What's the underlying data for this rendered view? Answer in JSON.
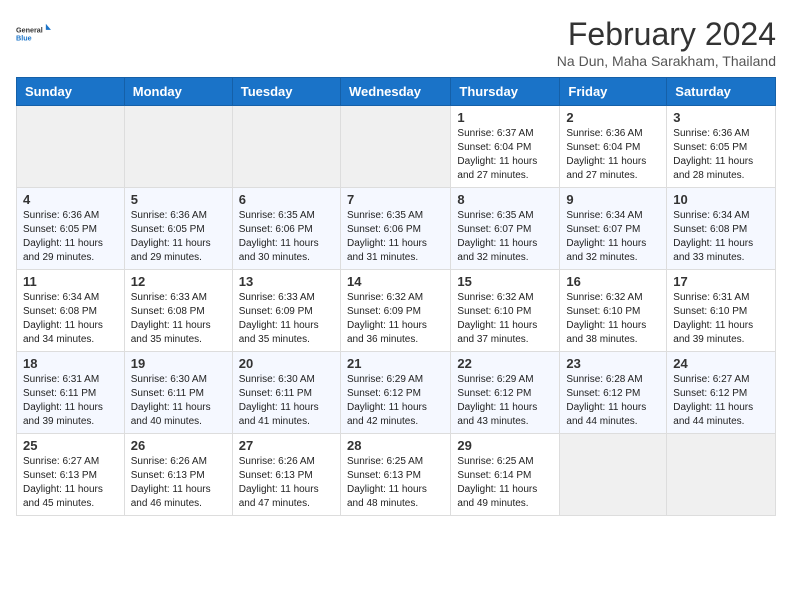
{
  "header": {
    "logo_general": "General",
    "logo_blue": "Blue",
    "month_title": "February 2024",
    "location": "Na Dun, Maha Sarakham, Thailand"
  },
  "weekdays": [
    "Sunday",
    "Monday",
    "Tuesday",
    "Wednesday",
    "Thursday",
    "Friday",
    "Saturday"
  ],
  "weeks": [
    [
      {
        "day": "",
        "sunrise": "",
        "sunset": "",
        "daylight": ""
      },
      {
        "day": "",
        "sunrise": "",
        "sunset": "",
        "daylight": ""
      },
      {
        "day": "",
        "sunrise": "",
        "sunset": "",
        "daylight": ""
      },
      {
        "day": "",
        "sunrise": "",
        "sunset": "",
        "daylight": ""
      },
      {
        "day": "1",
        "sunrise": "Sunrise: 6:37 AM",
        "sunset": "Sunset: 6:04 PM",
        "daylight": "Daylight: 11 hours and 27 minutes."
      },
      {
        "day": "2",
        "sunrise": "Sunrise: 6:36 AM",
        "sunset": "Sunset: 6:04 PM",
        "daylight": "Daylight: 11 hours and 27 minutes."
      },
      {
        "day": "3",
        "sunrise": "Sunrise: 6:36 AM",
        "sunset": "Sunset: 6:05 PM",
        "daylight": "Daylight: 11 hours and 28 minutes."
      }
    ],
    [
      {
        "day": "4",
        "sunrise": "Sunrise: 6:36 AM",
        "sunset": "Sunset: 6:05 PM",
        "daylight": "Daylight: 11 hours and 29 minutes."
      },
      {
        "day": "5",
        "sunrise": "Sunrise: 6:36 AM",
        "sunset": "Sunset: 6:05 PM",
        "daylight": "Daylight: 11 hours and 29 minutes."
      },
      {
        "day": "6",
        "sunrise": "Sunrise: 6:35 AM",
        "sunset": "Sunset: 6:06 PM",
        "daylight": "Daylight: 11 hours and 30 minutes."
      },
      {
        "day": "7",
        "sunrise": "Sunrise: 6:35 AM",
        "sunset": "Sunset: 6:06 PM",
        "daylight": "Daylight: 11 hours and 31 minutes."
      },
      {
        "day": "8",
        "sunrise": "Sunrise: 6:35 AM",
        "sunset": "Sunset: 6:07 PM",
        "daylight": "Daylight: 11 hours and 32 minutes."
      },
      {
        "day": "9",
        "sunrise": "Sunrise: 6:34 AM",
        "sunset": "Sunset: 6:07 PM",
        "daylight": "Daylight: 11 hours and 32 minutes."
      },
      {
        "day": "10",
        "sunrise": "Sunrise: 6:34 AM",
        "sunset": "Sunset: 6:08 PM",
        "daylight": "Daylight: 11 hours and 33 minutes."
      }
    ],
    [
      {
        "day": "11",
        "sunrise": "Sunrise: 6:34 AM",
        "sunset": "Sunset: 6:08 PM",
        "daylight": "Daylight: 11 hours and 34 minutes."
      },
      {
        "day": "12",
        "sunrise": "Sunrise: 6:33 AM",
        "sunset": "Sunset: 6:08 PM",
        "daylight": "Daylight: 11 hours and 35 minutes."
      },
      {
        "day": "13",
        "sunrise": "Sunrise: 6:33 AM",
        "sunset": "Sunset: 6:09 PM",
        "daylight": "Daylight: 11 hours and 35 minutes."
      },
      {
        "day": "14",
        "sunrise": "Sunrise: 6:32 AM",
        "sunset": "Sunset: 6:09 PM",
        "daylight": "Daylight: 11 hours and 36 minutes."
      },
      {
        "day": "15",
        "sunrise": "Sunrise: 6:32 AM",
        "sunset": "Sunset: 6:10 PM",
        "daylight": "Daylight: 11 hours and 37 minutes."
      },
      {
        "day": "16",
        "sunrise": "Sunrise: 6:32 AM",
        "sunset": "Sunset: 6:10 PM",
        "daylight": "Daylight: 11 hours and 38 minutes."
      },
      {
        "day": "17",
        "sunrise": "Sunrise: 6:31 AM",
        "sunset": "Sunset: 6:10 PM",
        "daylight": "Daylight: 11 hours and 39 minutes."
      }
    ],
    [
      {
        "day": "18",
        "sunrise": "Sunrise: 6:31 AM",
        "sunset": "Sunset: 6:11 PM",
        "daylight": "Daylight: 11 hours and 39 minutes."
      },
      {
        "day": "19",
        "sunrise": "Sunrise: 6:30 AM",
        "sunset": "Sunset: 6:11 PM",
        "daylight": "Daylight: 11 hours and 40 minutes."
      },
      {
        "day": "20",
        "sunrise": "Sunrise: 6:30 AM",
        "sunset": "Sunset: 6:11 PM",
        "daylight": "Daylight: 11 hours and 41 minutes."
      },
      {
        "day": "21",
        "sunrise": "Sunrise: 6:29 AM",
        "sunset": "Sunset: 6:12 PM",
        "daylight": "Daylight: 11 hours and 42 minutes."
      },
      {
        "day": "22",
        "sunrise": "Sunrise: 6:29 AM",
        "sunset": "Sunset: 6:12 PM",
        "daylight": "Daylight: 11 hours and 43 minutes."
      },
      {
        "day": "23",
        "sunrise": "Sunrise: 6:28 AM",
        "sunset": "Sunset: 6:12 PM",
        "daylight": "Daylight: 11 hours and 44 minutes."
      },
      {
        "day": "24",
        "sunrise": "Sunrise: 6:27 AM",
        "sunset": "Sunset: 6:12 PM",
        "daylight": "Daylight: 11 hours and 44 minutes."
      }
    ],
    [
      {
        "day": "25",
        "sunrise": "Sunrise: 6:27 AM",
        "sunset": "Sunset: 6:13 PM",
        "daylight": "Daylight: 11 hours and 45 minutes."
      },
      {
        "day": "26",
        "sunrise": "Sunrise: 6:26 AM",
        "sunset": "Sunset: 6:13 PM",
        "daylight": "Daylight: 11 hours and 46 minutes."
      },
      {
        "day": "27",
        "sunrise": "Sunrise: 6:26 AM",
        "sunset": "Sunset: 6:13 PM",
        "daylight": "Daylight: 11 hours and 47 minutes."
      },
      {
        "day": "28",
        "sunrise": "Sunrise: 6:25 AM",
        "sunset": "Sunset: 6:13 PM",
        "daylight": "Daylight: 11 hours and 48 minutes."
      },
      {
        "day": "29",
        "sunrise": "Sunrise: 6:25 AM",
        "sunset": "Sunset: 6:14 PM",
        "daylight": "Daylight: 11 hours and 49 minutes."
      },
      {
        "day": "",
        "sunrise": "",
        "sunset": "",
        "daylight": ""
      },
      {
        "day": "",
        "sunrise": "",
        "sunset": "",
        "daylight": ""
      }
    ]
  ]
}
